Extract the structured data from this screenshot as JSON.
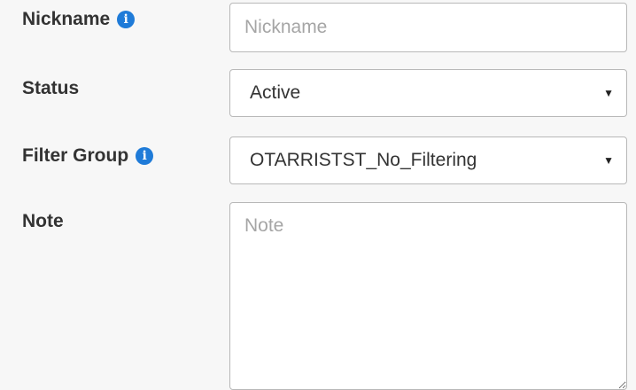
{
  "form": {
    "nickname": {
      "label": "Nickname",
      "info_icon": "info-icon",
      "placeholder": "Nickname",
      "value": ""
    },
    "status": {
      "label": "Status",
      "selected": "Active",
      "arrow": "▼"
    },
    "filter_group": {
      "label": "Filter Group",
      "info_icon": "info-icon",
      "selected": "OTARRISTST_No_Filtering",
      "arrow": "▼"
    },
    "note": {
      "label": "Note",
      "placeholder": "Note",
      "value": ""
    },
    "colors": {
      "info_icon": "#1f7bd8",
      "label_text": "#333333",
      "placeholder_text": "#a5a5a5",
      "border": "#b8b8b8",
      "background": "#f7f7f7"
    }
  }
}
